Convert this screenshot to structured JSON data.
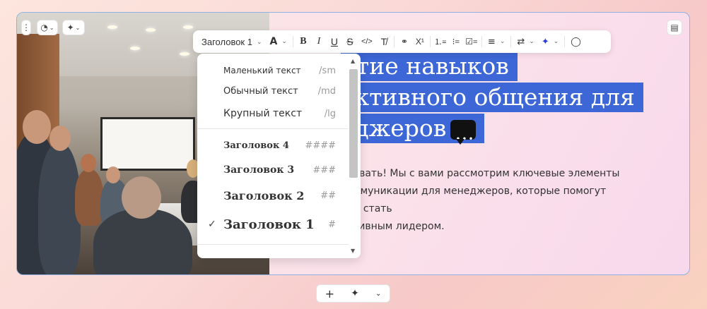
{
  "slide_controls": {
    "menu_icon": "kebab-vertical-icon",
    "palette_icon": "palette-icon",
    "ai_icon": "sparkle-icon",
    "notes_icon": "notes-icon"
  },
  "toolbar": {
    "style_label": "Заголовок 1",
    "text_color_label": "A",
    "bold": "B",
    "italic": "I",
    "underline": "U",
    "strike": "S",
    "code": "</>",
    "clear_format": "T̸",
    "link": "🔗",
    "superscript": "X¹"
  },
  "dropdown": {
    "items": [
      {
        "label": "Маленький текст",
        "shortcut": "/sm"
      },
      {
        "label": "Обычный текст",
        "shortcut": "/md"
      },
      {
        "label": "Крупный текст",
        "shortcut": "/lg"
      },
      {
        "label": "Заголовок 4",
        "shortcut": "####"
      },
      {
        "label": "Заголовок 3",
        "shortcut": "###"
      },
      {
        "label": "Заголовок 2",
        "shortcut": "##"
      },
      {
        "label": "Заголовок 1",
        "shortcut": "#",
        "selected": true
      }
    ]
  },
  "content": {
    "title_lines": [
      "итие навыков",
      "ективного общения для",
      "еджеров"
    ],
    "body_lines": [
      "аловать! Мы с вами рассмотрим ключевые элементы",
      "коммуникации для менеджеров, которые помогут вам стать",
      "ективным лидером."
    ]
  },
  "bottom_bar": {
    "add_label": "+",
    "ai_icon": "sparkle-icon",
    "more_icon": "chevron-down-icon"
  },
  "colors": {
    "selection": "#3d67d6",
    "slide_border": "#8fb1e3",
    "ai_accent": "#2b3dd8"
  }
}
